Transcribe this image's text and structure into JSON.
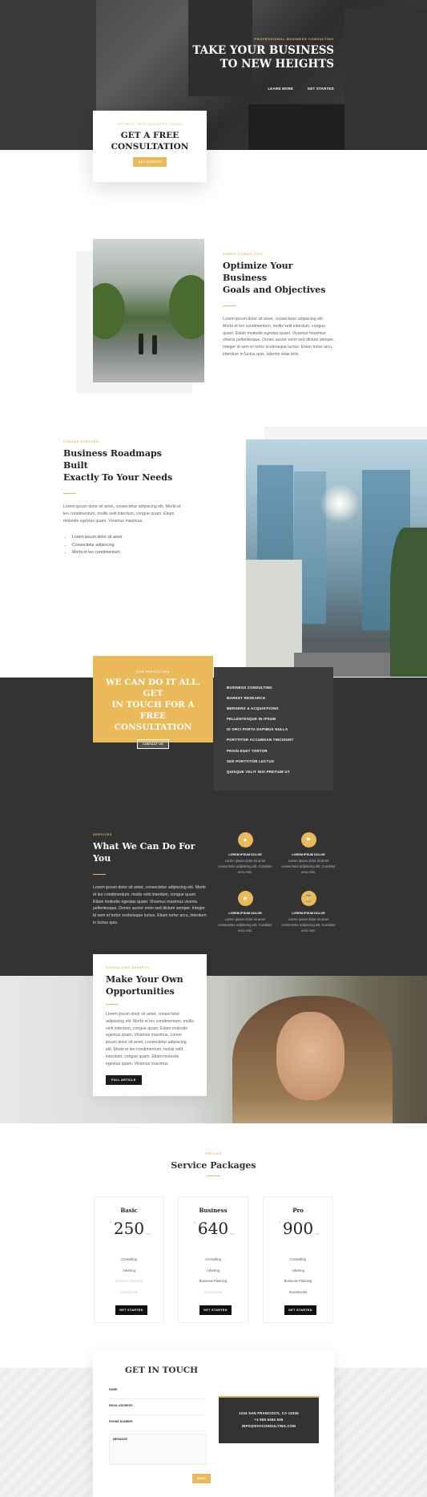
{
  "hero": {
    "eyebrow": "PROFESSIONAL BUSINESS CONSULTING",
    "title_line1": "TAKE YOUR BUSINESS",
    "title_line2": "TO NEW HEIGHTS",
    "btn_learn": "LEARN MORE",
    "btn_start": "GET STARTED"
  },
  "consult": {
    "eyebrow": "OPTIMIZE YOUR BUSINESS TODAY!",
    "title_line1": "GET A FREE",
    "title_line2": "CONSULTATION",
    "button": "GET STARTED"
  },
  "optimize": {
    "eyebrow": "SIMPLY CONSULTING",
    "title_line1": "Optimize Your Business",
    "title_line2": "Goals and Objectives",
    "body": "Lorem ipsum dolor sit amet, consectetur adipiscing elit. Morbi et leo condimentum, mollis velit interdum, congue quam. Etiam molestie egestas quam. Vivamus maximus viverra pellentesque. Donec auctor enim sed dictum semper. Integer id sem et tortor scelerisque luctus. Etiam tortor arcu, interdum in luctus quis, lobortis vitae felis."
  },
  "roadmaps": {
    "eyebrow": "CHANGE FOREVER",
    "title_line1": "Business Roadmaps Built",
    "title_line2": "Exactly To Your Needs",
    "body": "Lorem ipsum dolor sit amet, consectetur adipiscing elit. Morbi et leo condimentum, mollis velit interdum, congue quam. Etiam molestie egestas quam. Vivamus maximus.",
    "list": [
      "Lorem ipsum dolor sit amet",
      "Consectetur adipiscing",
      "Morbi et leo condimentum"
    ]
  },
  "cta": {
    "eyebrow": "OUR SPECIALTIES",
    "title_line1": "WE CAN DO IT ALL. GET",
    "title_line2": "IN TOUCH FOR A FREE",
    "title_line3": "CONSULTATION",
    "button": "CONTACT US"
  },
  "services_list": [
    "BUSINESS CONSULTING",
    "MARKET RESEARCH",
    "MERGERS & ACQUISITIONS",
    "PELLENTESQUE IN IPSUM",
    "ID ORCI PORTA DAPIBUS NULLA",
    "PORTTITOR ACCUMSAN TINCIDUNT",
    "PROIN EGET TORTOR",
    "SED PORTTITOR LECTUS",
    "QUISQUE VELIT NISI PRETIUM UT"
  ],
  "what": {
    "eyebrow": "SERVICES",
    "title": "What We Can Do For You",
    "body": "Lorem ipsum dolor sit amet, consectetur adipiscing elit. Morbi et leo condimentum, mollis velit interdum, congue quam. Etiam molestie egestas quam. Vivamus maximus viverra pellentesque. Donec auctor enim sed dictum semper. Integer id sem et tortor scelerisque luctus. Etiam tortor arcu, interdum in luctus quis."
  },
  "features": [
    {
      "title": "LOREM IPSUM DOLOR",
      "text": "Lorem ipsum dolor sit amet consectetur adipiscing elit. Curabitur arcu erat."
    },
    {
      "title": "LOREM IPSUM DOLOR",
      "text": "Lorem ipsum dolor sit amet consectetur adipiscing elit. Curabitur arcu erat."
    },
    {
      "title": "LOREM IPSUM DOLOR",
      "text": "Lorem ipsum dolor sit amet consectetur adipiscing elit. Curabitur arcu erat."
    },
    {
      "title": "LOREM IPSUM DOLOR",
      "text": "Lorem ipsum dolor sit amet consectetur adipiscing elit. Curabitur arcu erat."
    }
  ],
  "feature_icons": [
    "comment-icon",
    "bookmark-icon",
    "lightbulb-icon",
    "hourglass-icon"
  ],
  "opportunities": {
    "eyebrow": "CONSULTING EXPERTS",
    "title_line1": "Make Your Own",
    "title_line2": "Opportunities",
    "body": "Lorem ipsum dolor sit amet, consectetur adipiscing elit. Morbi et leo condimentum, mollis velit interdum, congue quam. Etiam molestie egestas quam. Vivamus maximus. Lorem ipsum dolor sit amet, consectetur adipiscing elit. Morbi et leo condimentum, mollis velit interdum, congue quam. Etiam molestie egestas quam. Vivamus maximus.",
    "button": "FULL ARTICLE"
  },
  "pricing": {
    "eyebrow": "PRICING",
    "title": "Service Packages",
    "plans": [
      {
        "name": "Basic",
        "currency": "$",
        "price": "250",
        "per": "/mo",
        "features": [
          "Consulting",
          "Advising",
          "Business Planning",
          "Investments"
        ],
        "button": "GET STARTED"
      },
      {
        "name": "Business",
        "currency": "$",
        "price": "640",
        "per": "/mo",
        "features": [
          "Consulting",
          "Advising",
          "Business Planning",
          "Investments"
        ],
        "button": "GET STARTED"
      },
      {
        "name": "Pro",
        "currency": "$",
        "price": "900",
        "per": "/mo",
        "features": [
          "Consulting",
          "Advising",
          "Business Planning",
          "Investments"
        ],
        "button": "GET STARTED"
      }
    ]
  },
  "contact": {
    "title": "GET IN TOUCH",
    "fields": [
      "NAME",
      "EMAIL ADDRESS",
      "PHONE NUMBER"
    ],
    "message": "MESSAGE",
    "send": "SEND",
    "address": "1234 SAN FRANCISCO, CA 12345",
    "phone": "+1 555 5364 645",
    "email": "INFO@DIVICONSULTING.COM"
  },
  "colors": {
    "accent": "#e9b95a",
    "dark": "#333333"
  }
}
